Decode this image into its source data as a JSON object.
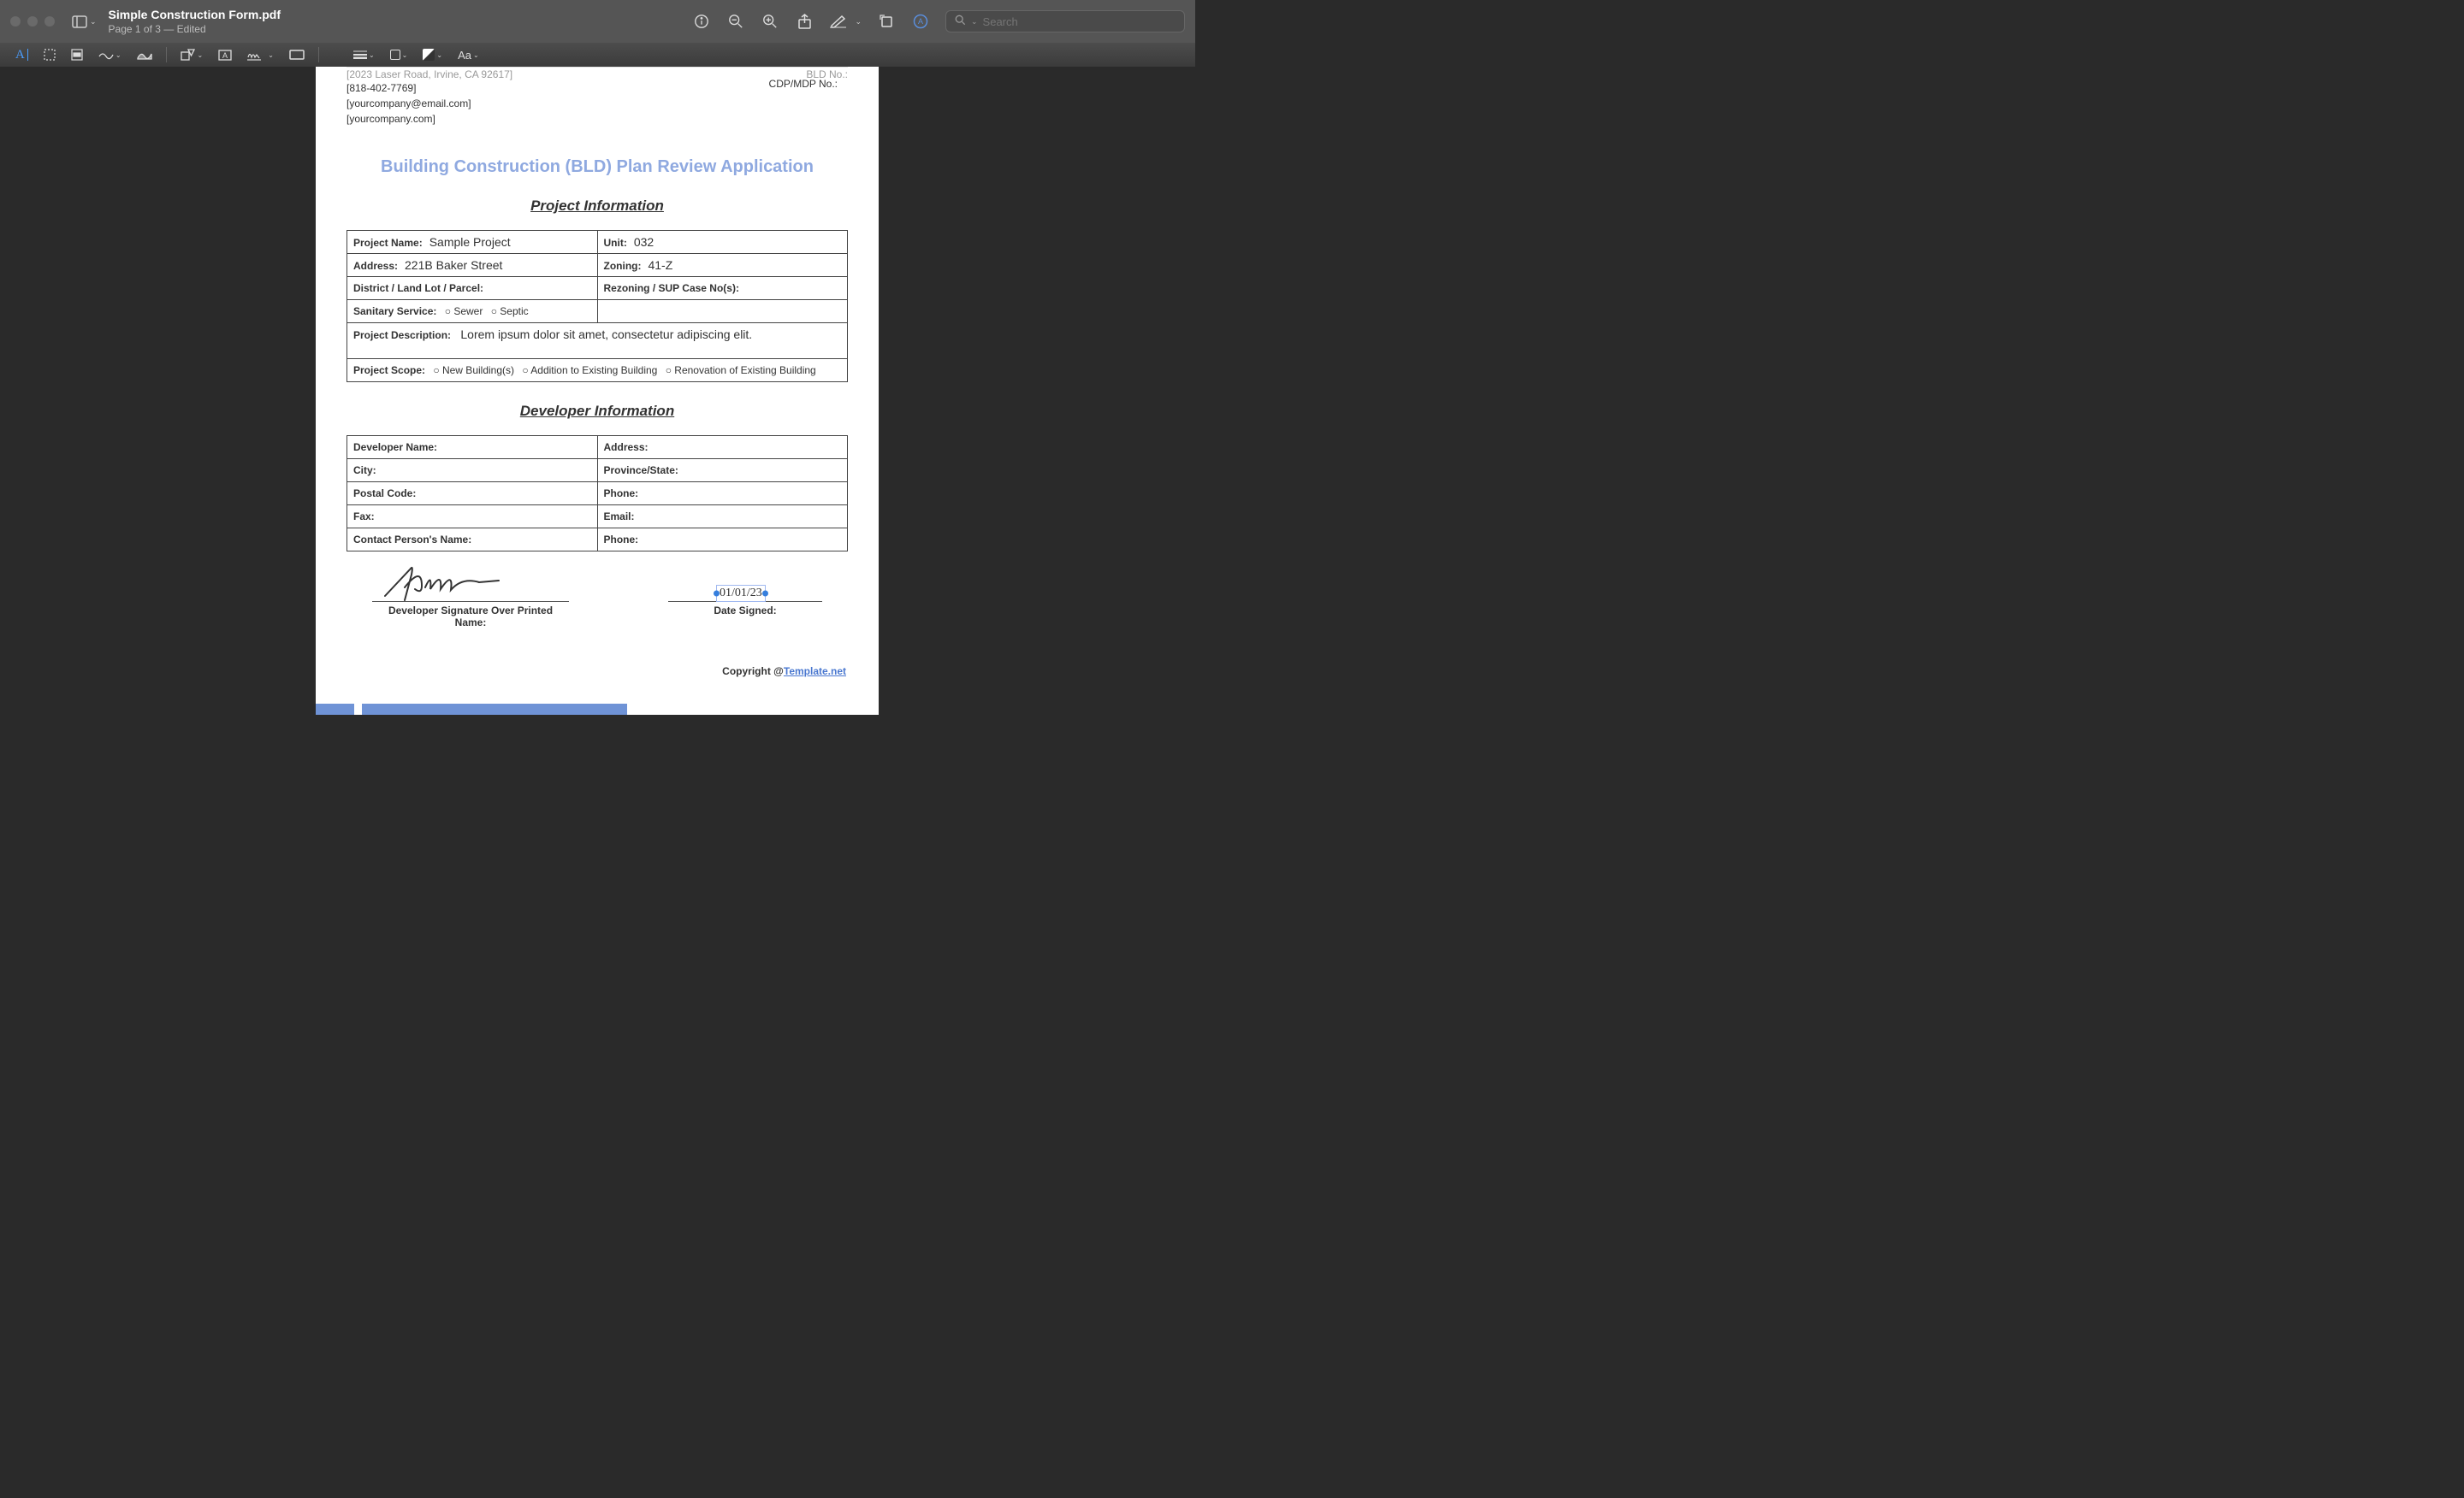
{
  "window": {
    "title": "Simple Construction Form.pdf",
    "subtitle": "Page 1 of 3 — Edited",
    "search_placeholder": "Search"
  },
  "doc": {
    "company_address": "[2023 Laser Road, Irvine, CA 92617]",
    "company_phone": "[818-402-7769]",
    "company_email": "[yourcompany@email.com]",
    "company_web": "[yourcompany.com]",
    "bld_no_label": "BLD No.:",
    "cdp_label": "CDP/MDP No.:",
    "title": "Building Construction (BLD) Plan Review Application",
    "section_project": "Project Information",
    "section_developer": "Developer Information",
    "project_name_label": "Project Name:",
    "project_name_val": "Sample Project",
    "unit_label": "Unit:",
    "unit_val": "032",
    "address_label": "Address:",
    "address_val": "221B Baker Street",
    "zoning_label": "Zoning:",
    "zoning_val": "41-Z",
    "district_label": "District / Land Lot / Parcel:",
    "rezoning_label": "Rezoning / SUP Case No(s):",
    "sanitary_label": "Sanitary Service:",
    "sewer": "Sewer",
    "septic": "Septic",
    "desc_label": "Project Description:",
    "desc_val": "Lorem ipsum dolor sit amet, consectetur adipiscing elit.",
    "scope_label": "Project Scope:",
    "scope1": "New Building(s)",
    "scope2": "Addition to Existing Building",
    "scope3": "Renovation of Existing Building",
    "dev_name": "Developer Name:",
    "dev_addr": "Address:",
    "dev_city": "City:",
    "dev_prov": "Province/State:",
    "dev_postal": "Postal Code:",
    "dev_phone": "Phone:",
    "dev_fax": "Fax:",
    "dev_email": "Email:",
    "dev_contact": "Contact Person's Name:",
    "dev_phone2": "Phone:",
    "sig_label": "Developer Signature Over Printed Name:",
    "date_label": "Date Signed:",
    "date_val": "01/01/23",
    "copyright_pre": "Copyright @",
    "copyright_link": "Template.net"
  }
}
